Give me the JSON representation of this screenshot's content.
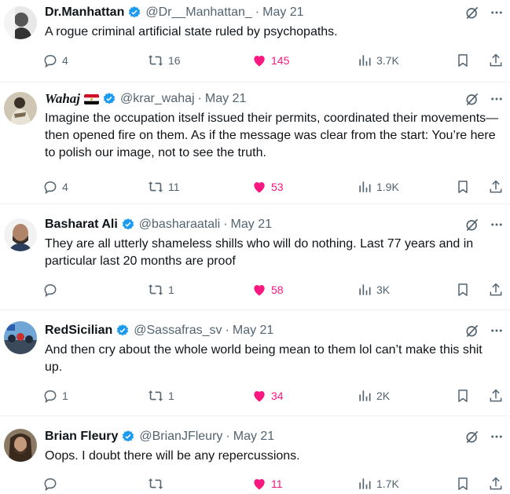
{
  "tweets": [
    {
      "name": "Dr.Manhattan",
      "handle": "@Dr__Manhattan_",
      "date": "May 21",
      "text": "A rogue criminal artificial state ruled by psychopaths.",
      "replies": "4",
      "retweets": "16",
      "likes": "145",
      "views": "3.7K",
      "avatar": "grayscale-portrait"
    },
    {
      "name": "Wahaj",
      "flag": "egypt-flag",
      "handle": "@krar_wahaj",
      "date": "May 21",
      "text": "Imagine the occupation itself issued their permits, coordinated their movements—then opened fire on them. As if the message was clear from the start: You’re here to polish our image, not to see the truth.",
      "replies": "4",
      "retweets": "11",
      "likes": "53",
      "views": "1.9K",
      "avatar": "robed-figure"
    },
    {
      "name": "Basharat Ali",
      "handle": "@basharaatali",
      "date": "May 21",
      "text": "They are all utterly shameless shills who will do nothing. Last 77 years and in particular last 20 months are proof",
      "replies": "",
      "retweets": "1",
      "likes": "58",
      "views": "3K",
      "avatar": "bearded-man"
    },
    {
      "name": "RedSicilian",
      "handle": "@Sassafras_sv",
      "date": "May 21",
      "text": "And then cry about the whole world being mean to them lol can’t make this shit up.",
      "replies": "1",
      "retweets": "1",
      "likes": "34",
      "views": "2K",
      "avatar": "crowd-scene"
    },
    {
      "name": "Brian Fleury",
      "handle": "@BrianJFleury",
      "date": "May 21",
      "text": "Oops. I doubt there will be any repercussions.",
      "replies": "",
      "retweets": "",
      "likes": "11",
      "views": "1.7K",
      "avatar": "long-hair-man"
    }
  ],
  "colors": {
    "like": "#f91880",
    "verified": "#1d9bf0",
    "secondary_text": "#536471",
    "primary_text": "#0f1419"
  }
}
